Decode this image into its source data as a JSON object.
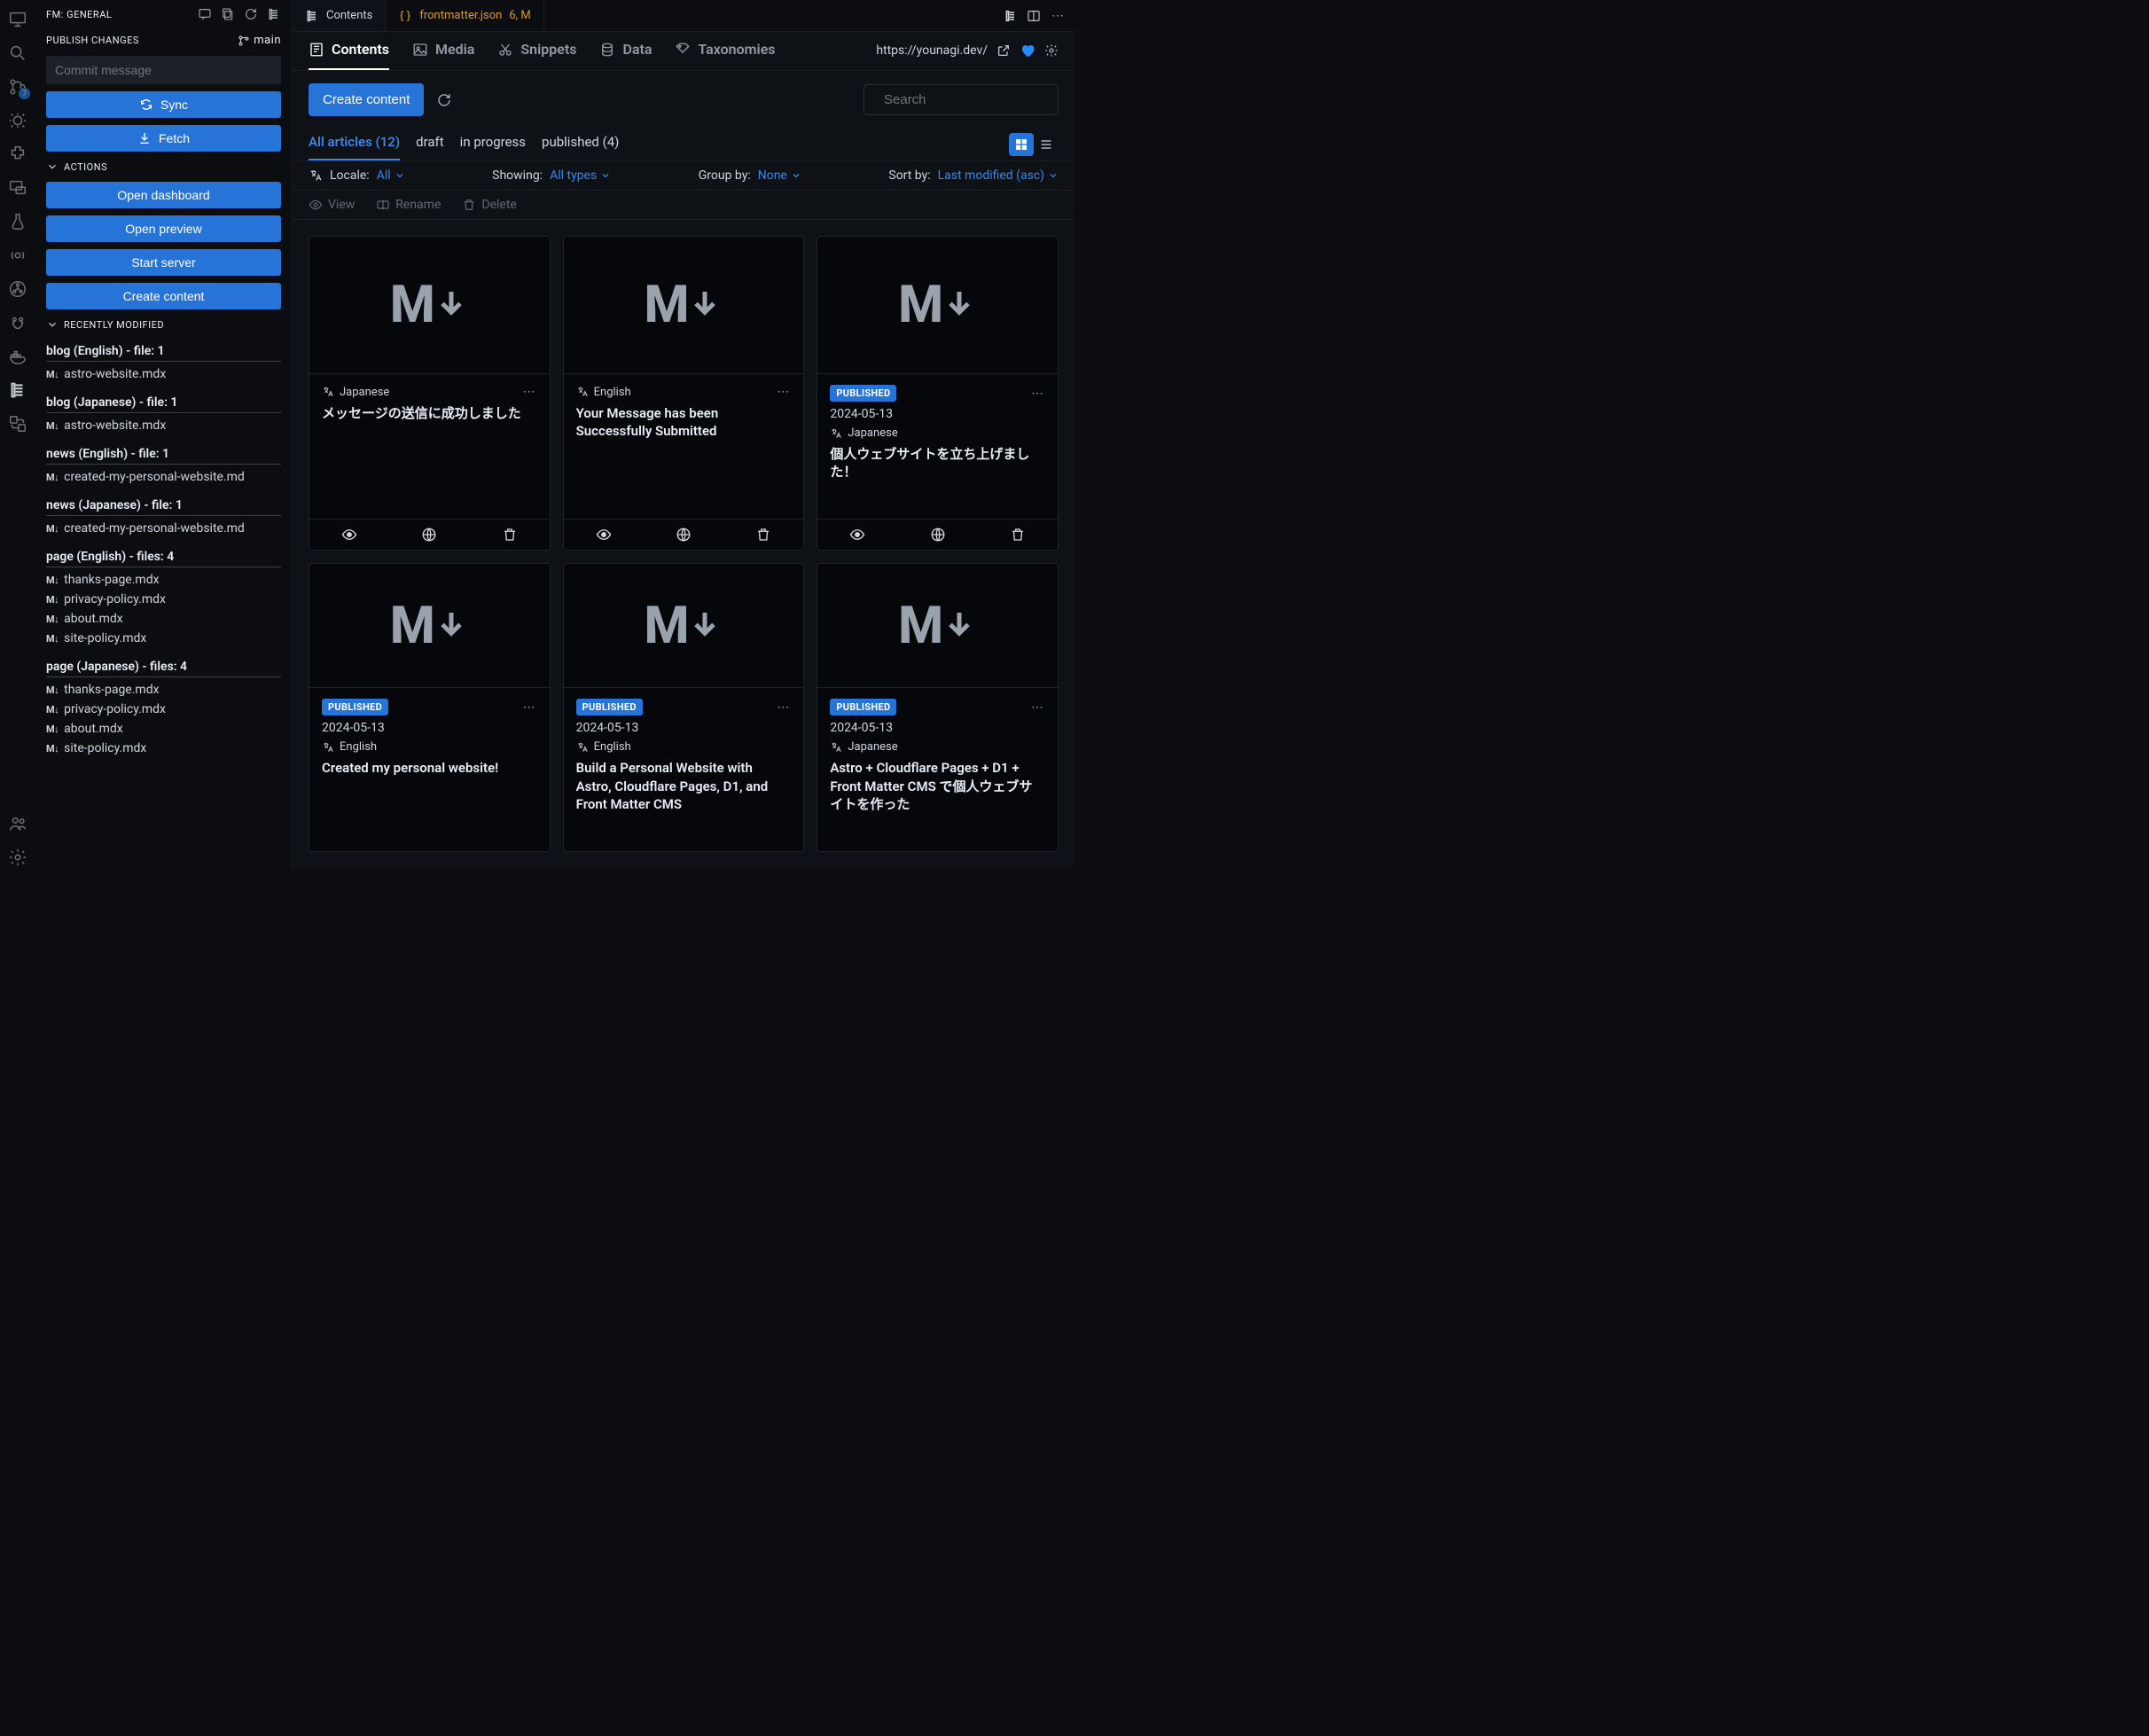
{
  "activitybar": {
    "badge_scm": "7"
  },
  "sidebar": {
    "header": "FM: GENERAL",
    "publish_label": "PUBLISH CHANGES",
    "branch": "main",
    "commit_placeholder": "Commit message",
    "sync_btn": "Sync",
    "fetch_btn": "Fetch",
    "actions_label": "ACTIONS",
    "open_dashboard": "Open dashboard",
    "open_preview": "Open preview",
    "start_server": "Start server",
    "create_content": "Create content",
    "recent_label": "RECENTLY MODIFIED",
    "groups": [
      {
        "title": "blog (English) - file: 1",
        "files": [
          "astro-website.mdx"
        ]
      },
      {
        "title": "blog (Japanese) - file: 1",
        "files": [
          "astro-website.mdx"
        ]
      },
      {
        "title": "news (English) - file: 1",
        "files": [
          "created-my-personal-website.md"
        ]
      },
      {
        "title": "news (Japanese) - file: 1",
        "files": [
          "created-my-personal-website.md"
        ]
      },
      {
        "title": "page (English) - files: 4",
        "files": [
          "thanks-page.mdx",
          "privacy-policy.mdx",
          "about.mdx",
          "site-policy.mdx"
        ]
      },
      {
        "title": "page (Japanese) - files: 4",
        "files": [
          "thanks-page.mdx",
          "privacy-policy.mdx",
          "about.mdx",
          "site-policy.mdx"
        ]
      }
    ]
  },
  "tabs": {
    "t1": "Contents",
    "t2_name": "frontmatter.json",
    "t2_badge": "6, M"
  },
  "nav": {
    "contents": "Contents",
    "media": "Media",
    "snippets": "Snippets",
    "data": "Data",
    "taxonomies": "Taxonomies",
    "site_url": "https://younagi.dev/"
  },
  "toolbar": {
    "create": "Create content",
    "search_placeholder": "Search"
  },
  "filters": {
    "all_articles": "All articles (12)",
    "draft": "draft",
    "in_progress": "in progress",
    "published": "published (4)",
    "locale_label": "Locale:",
    "locale_val": "All",
    "showing_label": "Showing:",
    "showing_val": "All types",
    "group_label": "Group by:",
    "group_val": "None",
    "sort_label": "Sort by:",
    "sort_val": "Last modified (asc)"
  },
  "row_actions": {
    "view": "View",
    "rename": "Rename",
    "delete": "Delete"
  },
  "cards": [
    {
      "published": false,
      "lang": "Japanese",
      "title": "メッセージの送信に成功しました",
      "date": ""
    },
    {
      "published": false,
      "lang": "English",
      "title": "Your Message has been Successfully Submitted",
      "date": ""
    },
    {
      "published": true,
      "lang": "Japanese",
      "title": "個人ウェブサイトを立ち上げました！",
      "date": "2024-05-13"
    },
    {
      "published": true,
      "lang": "English",
      "title": "Created my personal website!",
      "date": "2024-05-13"
    },
    {
      "published": true,
      "lang": "English",
      "title": "Build a Personal Website with Astro, Cloudflare Pages, D1, and Front Matter CMS",
      "date": "2024-05-13"
    },
    {
      "published": true,
      "lang": "Japanese",
      "title": "Astro + Cloudflare Pages + D1 + Front Matter CMS で個人ウェブサイトを作った",
      "date": "2024-05-13"
    }
  ],
  "labels": {
    "published_badge": "PUBLISHED"
  }
}
